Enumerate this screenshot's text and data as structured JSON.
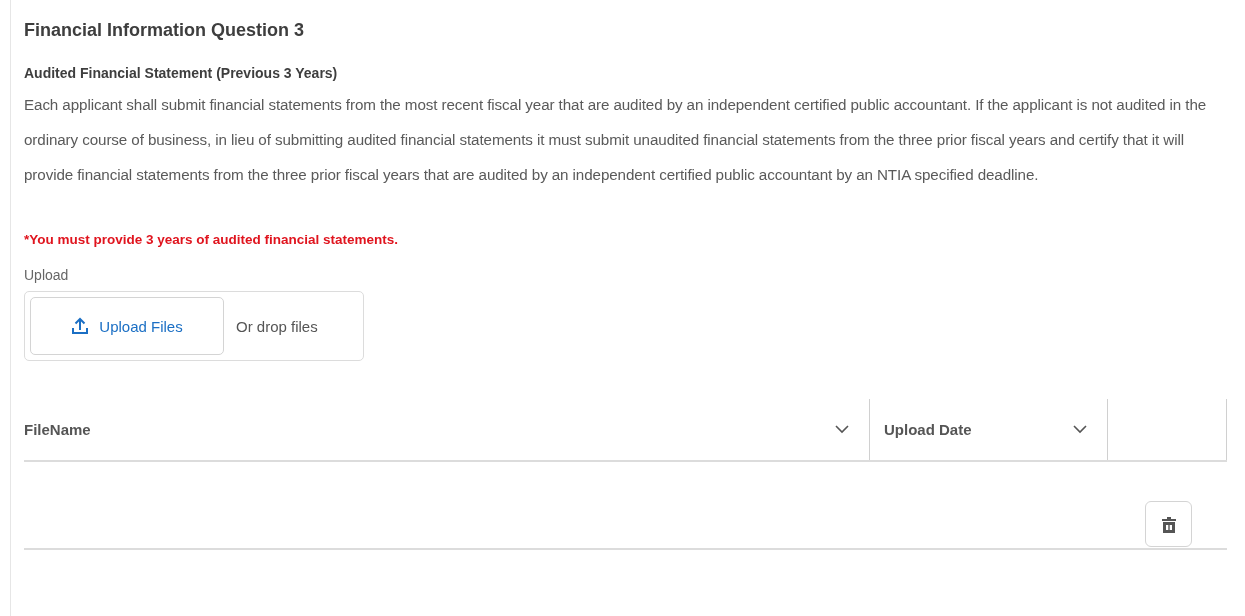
{
  "section": {
    "title": "Financial Information Question 3",
    "subtitle": "Audited Financial Statement (Previous 3 Years)",
    "description": "Each applicant shall submit financial statements from the most recent fiscal year that are audited by an independent certified public accountant. If the applicant is not audited in the ordinary course of business, in lieu of submitting audited financial statements it must submit unaudited financial statements from the three prior fiscal years and certify that it will provide financial statements from the three prior fiscal years that are audited by an independent certified public accountant by an NTIA specified deadline.",
    "requirement": "*You must provide 3 years of audited financial statements."
  },
  "upload": {
    "label": "Upload",
    "button": "Upload Files",
    "drop_hint": "Or drop files"
  },
  "table": {
    "columns": [
      {
        "label": "FileName",
        "sortable": true
      },
      {
        "label": "Upload Date",
        "sortable": true
      }
    ],
    "rows": [
      {
        "kind": "empty"
      }
    ]
  }
}
